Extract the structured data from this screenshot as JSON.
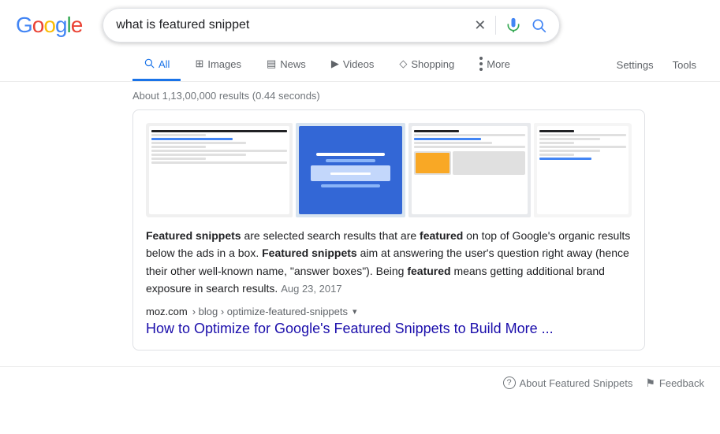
{
  "header": {
    "logo": "Google",
    "search_query": "what is featured snippet"
  },
  "nav": {
    "tabs": [
      {
        "label": "All",
        "icon": "🔍",
        "active": true
      },
      {
        "label": "Images",
        "icon": "🖼",
        "active": false
      },
      {
        "label": "News",
        "icon": "📰",
        "active": false
      },
      {
        "label": "Videos",
        "icon": "▶",
        "active": false
      },
      {
        "label": "Shopping",
        "icon": "🛍",
        "active": false
      },
      {
        "label": "More",
        "icon": "⋮",
        "active": false
      }
    ],
    "right": [
      "Settings",
      "Tools"
    ]
  },
  "results": {
    "count_text": "About 1,13,00,000 results (0.44 seconds)",
    "featured_snippet": {
      "snippet_text_parts": [
        {
          "text": "Featured snippets",
          "bold": true
        },
        {
          "text": " are selected search results that are ",
          "bold": false
        },
        {
          "text": "featured",
          "bold": true
        },
        {
          "text": " on top of Google's organic results below the ads in a box. ",
          "bold": false
        },
        {
          "text": "Featured snippets",
          "bold": true
        },
        {
          "text": " aim at answering the user's question right away (hence their other well-known name, \"answer boxes\"). Being ",
          "bold": false
        },
        {
          "text": "featured",
          "bold": true
        },
        {
          "text": " means getting additional brand exposure in search results.",
          "bold": false
        }
      ],
      "date": "Aug 23, 2017",
      "source_domain": "moz.com",
      "source_path": "› blog › optimize-featured-snippets",
      "title": "How to Optimize for Google's Featured Snippets to Build More ...",
      "url": "#"
    }
  },
  "footer": {
    "about_label": "About Featured Snippets",
    "feedback_label": "Feedback"
  },
  "icons": {
    "close": "✕",
    "mic_label": "mic-icon",
    "search_label": "search-icon",
    "question_mark": "?",
    "feedback_icon": "⚑"
  }
}
